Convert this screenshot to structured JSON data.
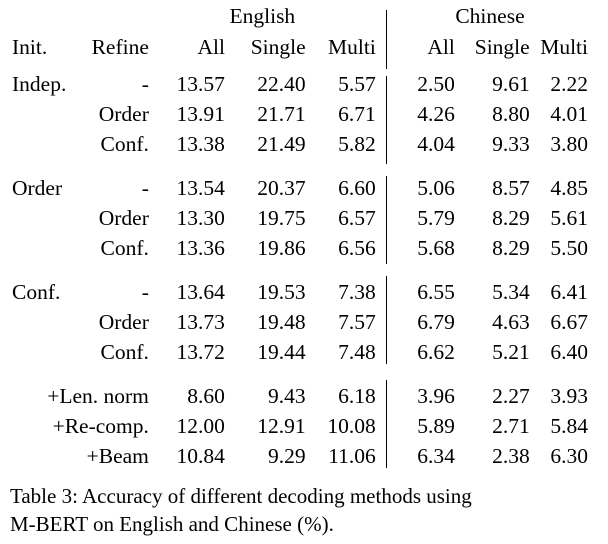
{
  "table": {
    "number": "Table 3",
    "caption_line1": "Table 3: Accuracy of different decoding methods using",
    "caption_line2": "M-BERT on English and Chinese (%).",
    "group_headers": {
      "spacer": "",
      "english": "English",
      "chinese": "Chinese"
    },
    "column_headers": {
      "init": "Init.",
      "refine": "Refine",
      "en_all": "All",
      "en_single": "Single",
      "en_multi": "Multi",
      "zh_all": "All",
      "zh_single": "Single",
      "zh_multi": "Multi"
    },
    "blocks": [
      {
        "rows": [
          {
            "init": "Indep.",
            "refine": "-",
            "en_all": "13.57",
            "en_single": "22.40",
            "en_multi": "5.57",
            "zh_all": "2.50",
            "zh_single": "9.61",
            "zh_multi": "2.22"
          },
          {
            "init": "",
            "refine": "Order",
            "en_all": "13.91",
            "en_single": "21.71",
            "en_multi": "6.71",
            "zh_all": "4.26",
            "zh_single": "8.80",
            "zh_multi": "4.01"
          },
          {
            "init": "",
            "refine": "Conf.",
            "en_all": "13.38",
            "en_single": "21.49",
            "en_multi": "5.82",
            "zh_all": "4.04",
            "zh_single": "9.33",
            "zh_multi": "3.80"
          }
        ]
      },
      {
        "rows": [
          {
            "init": "Order",
            "refine": "-",
            "en_all": "13.54",
            "en_single": "20.37",
            "en_multi": "6.60",
            "zh_all": "5.06",
            "zh_single": "8.57",
            "zh_multi": "4.85"
          },
          {
            "init": "",
            "refine": "Order",
            "en_all": "13.30",
            "en_single": "19.75",
            "en_multi": "6.57",
            "zh_all": "5.79",
            "zh_single": "8.29",
            "zh_multi": "5.61"
          },
          {
            "init": "",
            "refine": "Conf.",
            "en_all": "13.36",
            "en_single": "19.86",
            "en_multi": "6.56",
            "zh_all": "5.68",
            "zh_single": "8.29",
            "zh_multi": "5.50"
          }
        ]
      },
      {
        "rows": [
          {
            "init": "Conf.",
            "refine": "-",
            "en_all": "13.64",
            "en_single": "19.53",
            "en_multi": "7.38",
            "zh_all": "6.55",
            "zh_single": "5.34",
            "zh_multi": "6.41"
          },
          {
            "init": "",
            "refine": "Order",
            "en_all": "13.73",
            "en_single": "19.48",
            "en_multi": "7.57",
            "zh_all": "6.79",
            "zh_single": "4.63",
            "zh_multi": "6.67"
          },
          {
            "init": "",
            "refine": "Conf.",
            "en_all": "13.72",
            "en_single": "19.44",
            "en_multi": "7.48",
            "zh_all": "6.62",
            "zh_single": "5.21",
            "zh_multi": "6.40"
          }
        ]
      },
      {
        "rows": [
          {
            "label": "+Len. norm",
            "en_all": "8.60",
            "en_single": "9.43",
            "en_multi": "6.18",
            "zh_all": "3.96",
            "zh_single": "2.27",
            "zh_multi": "3.93"
          },
          {
            "label": "+Re-comp.",
            "en_all": "12.00",
            "en_single": "12.91",
            "en_multi": "10.08",
            "zh_all": "5.89",
            "zh_single": "2.71",
            "zh_multi": "5.84"
          },
          {
            "label": "+Beam",
            "en_all": "10.84",
            "en_single": "9.29",
            "en_multi": "11.06",
            "zh_all": "6.34",
            "zh_single": "2.38",
            "zh_multi": "6.30"
          }
        ]
      }
    ]
  },
  "chart_data": {
    "type": "table",
    "title": "Accuracy of different decoding methods using M-BERT on English and Chinese (%)",
    "column_groups": [
      "English",
      "Chinese"
    ],
    "columns": [
      "Init.",
      "Refine",
      "All",
      "Single",
      "Multi",
      "All",
      "Single",
      "Multi"
    ],
    "rows": [
      [
        "Indep.",
        "-",
        13.57,
        22.4,
        5.57,
        2.5,
        9.61,
        2.22
      ],
      [
        "",
        "Order",
        13.91,
        21.71,
        6.71,
        4.26,
        8.8,
        4.01
      ],
      [
        "",
        "Conf.",
        13.38,
        21.49,
        5.82,
        4.04,
        9.33,
        3.8
      ],
      [
        "Order",
        "-",
        13.54,
        20.37,
        6.6,
        5.06,
        8.57,
        4.85
      ],
      [
        "",
        "Order",
        13.3,
        19.75,
        6.57,
        5.79,
        8.29,
        5.61
      ],
      [
        "",
        "Conf.",
        13.36,
        19.86,
        6.56,
        5.68,
        8.29,
        5.5
      ],
      [
        "Conf.",
        "-",
        13.64,
        19.53,
        7.38,
        6.55,
        5.34,
        6.41
      ],
      [
        "",
        "Order",
        13.73,
        19.48,
        7.57,
        6.79,
        4.63,
        6.67
      ],
      [
        "",
        "Conf.",
        13.72,
        19.44,
        7.48,
        6.62,
        5.21,
        6.4
      ],
      [
        "+Len. norm",
        "",
        8.6,
        9.43,
        6.18,
        3.96,
        2.27,
        3.93
      ],
      [
        "+Re-comp.",
        "",
        12.0,
        12.91,
        10.08,
        5.89,
        2.71,
        5.84
      ],
      [
        "+Beam",
        "",
        10.84,
        9.29,
        11.06,
        6.34,
        2.38,
        6.3
      ]
    ],
    "bold_cells": [
      {
        "row": 0,
        "col": "en_single",
        "value": 22.4
      },
      {
        "row": 0,
        "col": "zh_single",
        "value": 9.61
      },
      {
        "row": 1,
        "col": "en_all",
        "value": 13.91
      },
      {
        "row": 7,
        "col": "zh_all",
        "value": 6.79
      },
      {
        "row": 7,
        "col": "zh_multi",
        "value": 6.67
      },
      {
        "row": 11,
        "col": "en_multi",
        "value": 11.06
      }
    ],
    "units": "%"
  }
}
